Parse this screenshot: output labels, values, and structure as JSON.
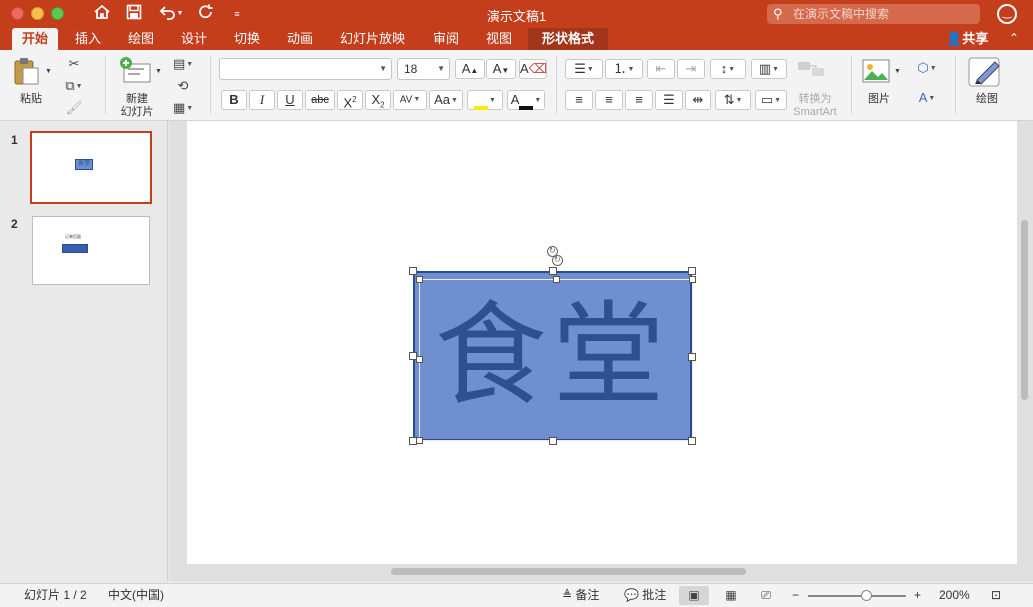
{
  "window": {
    "title": "演示文稿1",
    "search_placeholder": "在演示文稿中搜索"
  },
  "tabs": [
    {
      "label": "开始",
      "active": true
    },
    {
      "label": "插入"
    },
    {
      "label": "绘图"
    },
    {
      "label": "设计"
    },
    {
      "label": "切换"
    },
    {
      "label": "动画"
    },
    {
      "label": "幻灯片放映"
    },
    {
      "label": "审阅"
    },
    {
      "label": "视图"
    },
    {
      "label": "形状格式",
      "contextual": true
    }
  ],
  "share_label": "共享",
  "ribbon": {
    "paste_label": "粘贴",
    "new_slide_label_line1": "新建",
    "new_slide_label_line2": "幻灯片",
    "font_name": "",
    "font_size": "18",
    "bold": "B",
    "italic": "I",
    "underline": "U",
    "strikethrough": "abc",
    "convert_label_line1": "转换为",
    "convert_label_line2": "SmartArt",
    "picture_label": "图片",
    "draw_label": "绘图"
  },
  "thumbnails": [
    {
      "number": "1",
      "selected": true,
      "text": "食堂"
    },
    {
      "number": "2",
      "selected": false,
      "text": "订单页面"
    }
  ],
  "slide": {
    "shape_text": "食堂",
    "shape_fill": "#6f8fcf",
    "shape_border": "#2b4c8c",
    "text_color": "#2f4f93"
  },
  "status": {
    "slide_info": "幻灯片 1 / 2",
    "language": "中文(中国)",
    "notes_label": "备注",
    "comments_label": "批注",
    "zoom_level": "200%",
    "zoom_fraction": 0.6
  },
  "colors": {
    "accent": "#c43e1c"
  }
}
